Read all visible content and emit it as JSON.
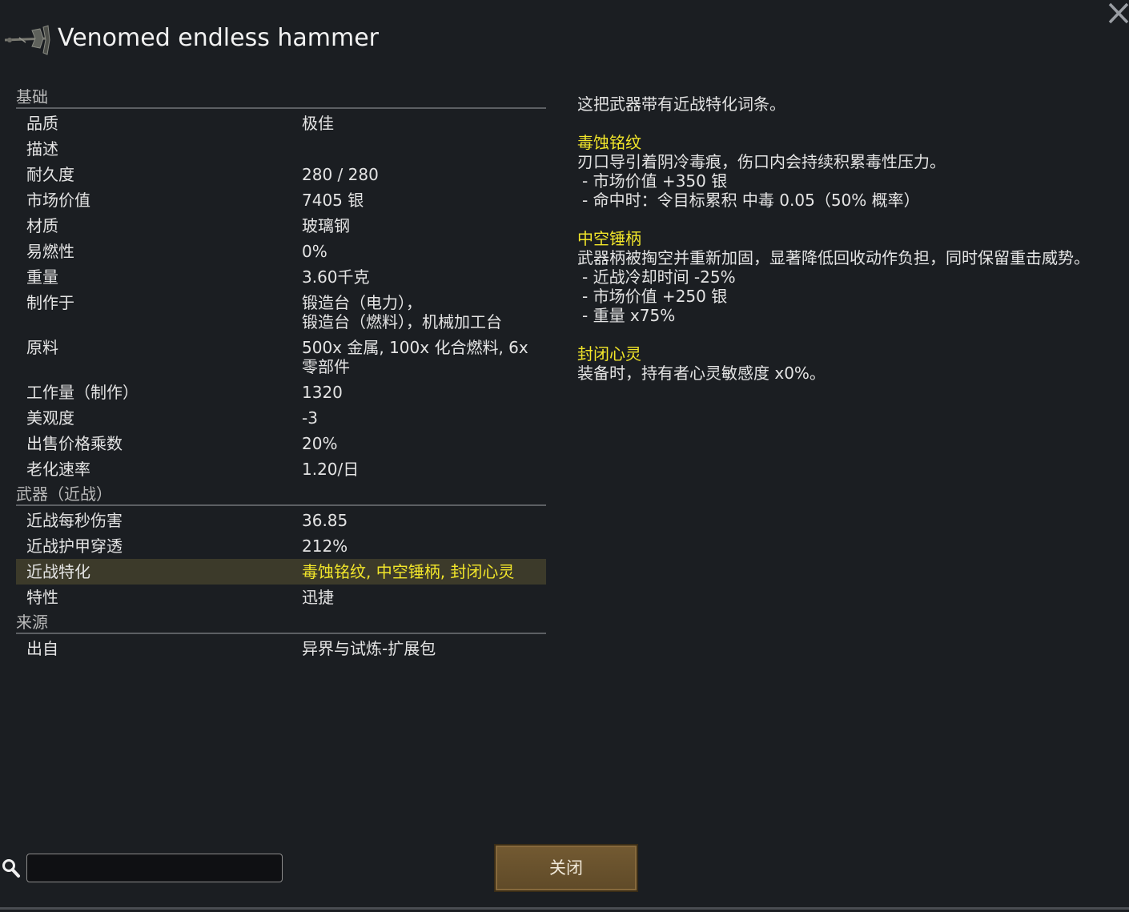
{
  "window": {
    "title": "Venomed endless hammer",
    "item_icon": "hammer-icon",
    "close_icon": "close-icon"
  },
  "sections": [
    {
      "header": "基础",
      "rows": [
        {
          "label": "品质",
          "value": "极佳"
        },
        {
          "label": "描述",
          "value": ""
        },
        {
          "label": "耐久度",
          "value": "280 / 280"
        },
        {
          "label": "市场价值",
          "value": "7405 银"
        },
        {
          "label": "材质",
          "value": "玻璃钢"
        },
        {
          "label": "易燃性",
          "value": "0%"
        },
        {
          "label": "重量",
          "value": "3.60千克"
        },
        {
          "label": "制作于",
          "value": "锻造台（电力），\n锻造台（燃料），机械加工台"
        },
        {
          "label": "原料",
          "value": "500x 金属, 100x 化合燃料, 6x\n零部件"
        },
        {
          "label": "工作量（制作）",
          "value": "1320"
        },
        {
          "label": "美观度",
          "value": "-3"
        },
        {
          "label": "出售价格乘数",
          "value": "20%"
        },
        {
          "label": "老化速率",
          "value": "1.20/日"
        }
      ]
    },
    {
      "header": "武器（近战）",
      "rows": [
        {
          "label": "近战每秒伤害",
          "value": "36.85"
        },
        {
          "label": "近战护甲穿透",
          "value": "212%"
        },
        {
          "label": "近战特化",
          "value": "毒蚀铭纹, 中空锤柄, 封闭心灵",
          "highlight": true
        },
        {
          "label": "特性",
          "value": "迅捷"
        }
      ]
    },
    {
      "header": "来源",
      "rows": [
        {
          "label": "出自",
          "value": "异界与试炼-扩展包"
        }
      ]
    }
  ],
  "details": {
    "intro": "这把武器带有近战特化词条。",
    "traits": [
      {
        "name": "毒蚀铭纹",
        "description": "刃口导引着阴冷毒痕，伤口内会持续积累毒性压力。",
        "effects": [
          "- 市场价值 +350 银",
          "- 命中时：令目标累积 中毒 0.05（50% 概率）"
        ]
      },
      {
        "name": "中空锤柄",
        "description": "武器柄被掏空并重新加固，显著降低回收动作负担，同时保留重击威势。",
        "effects": [
          "- 近战冷却时间 -25%",
          "- 市场价值 +250 银",
          "- 重量 x75%"
        ]
      },
      {
        "name": "封闭心灵",
        "description": "装备时，持有者心灵敏感度 x0%。",
        "effects": []
      }
    ]
  },
  "footer": {
    "search_icon": "search-icon",
    "search_value": "",
    "close_button_label": "关闭"
  },
  "colors": {
    "background": "#1b1e22",
    "highlight_text": "#f2e62a",
    "highlight_row": "#3c3a2a",
    "button": "#6b5330"
  }
}
